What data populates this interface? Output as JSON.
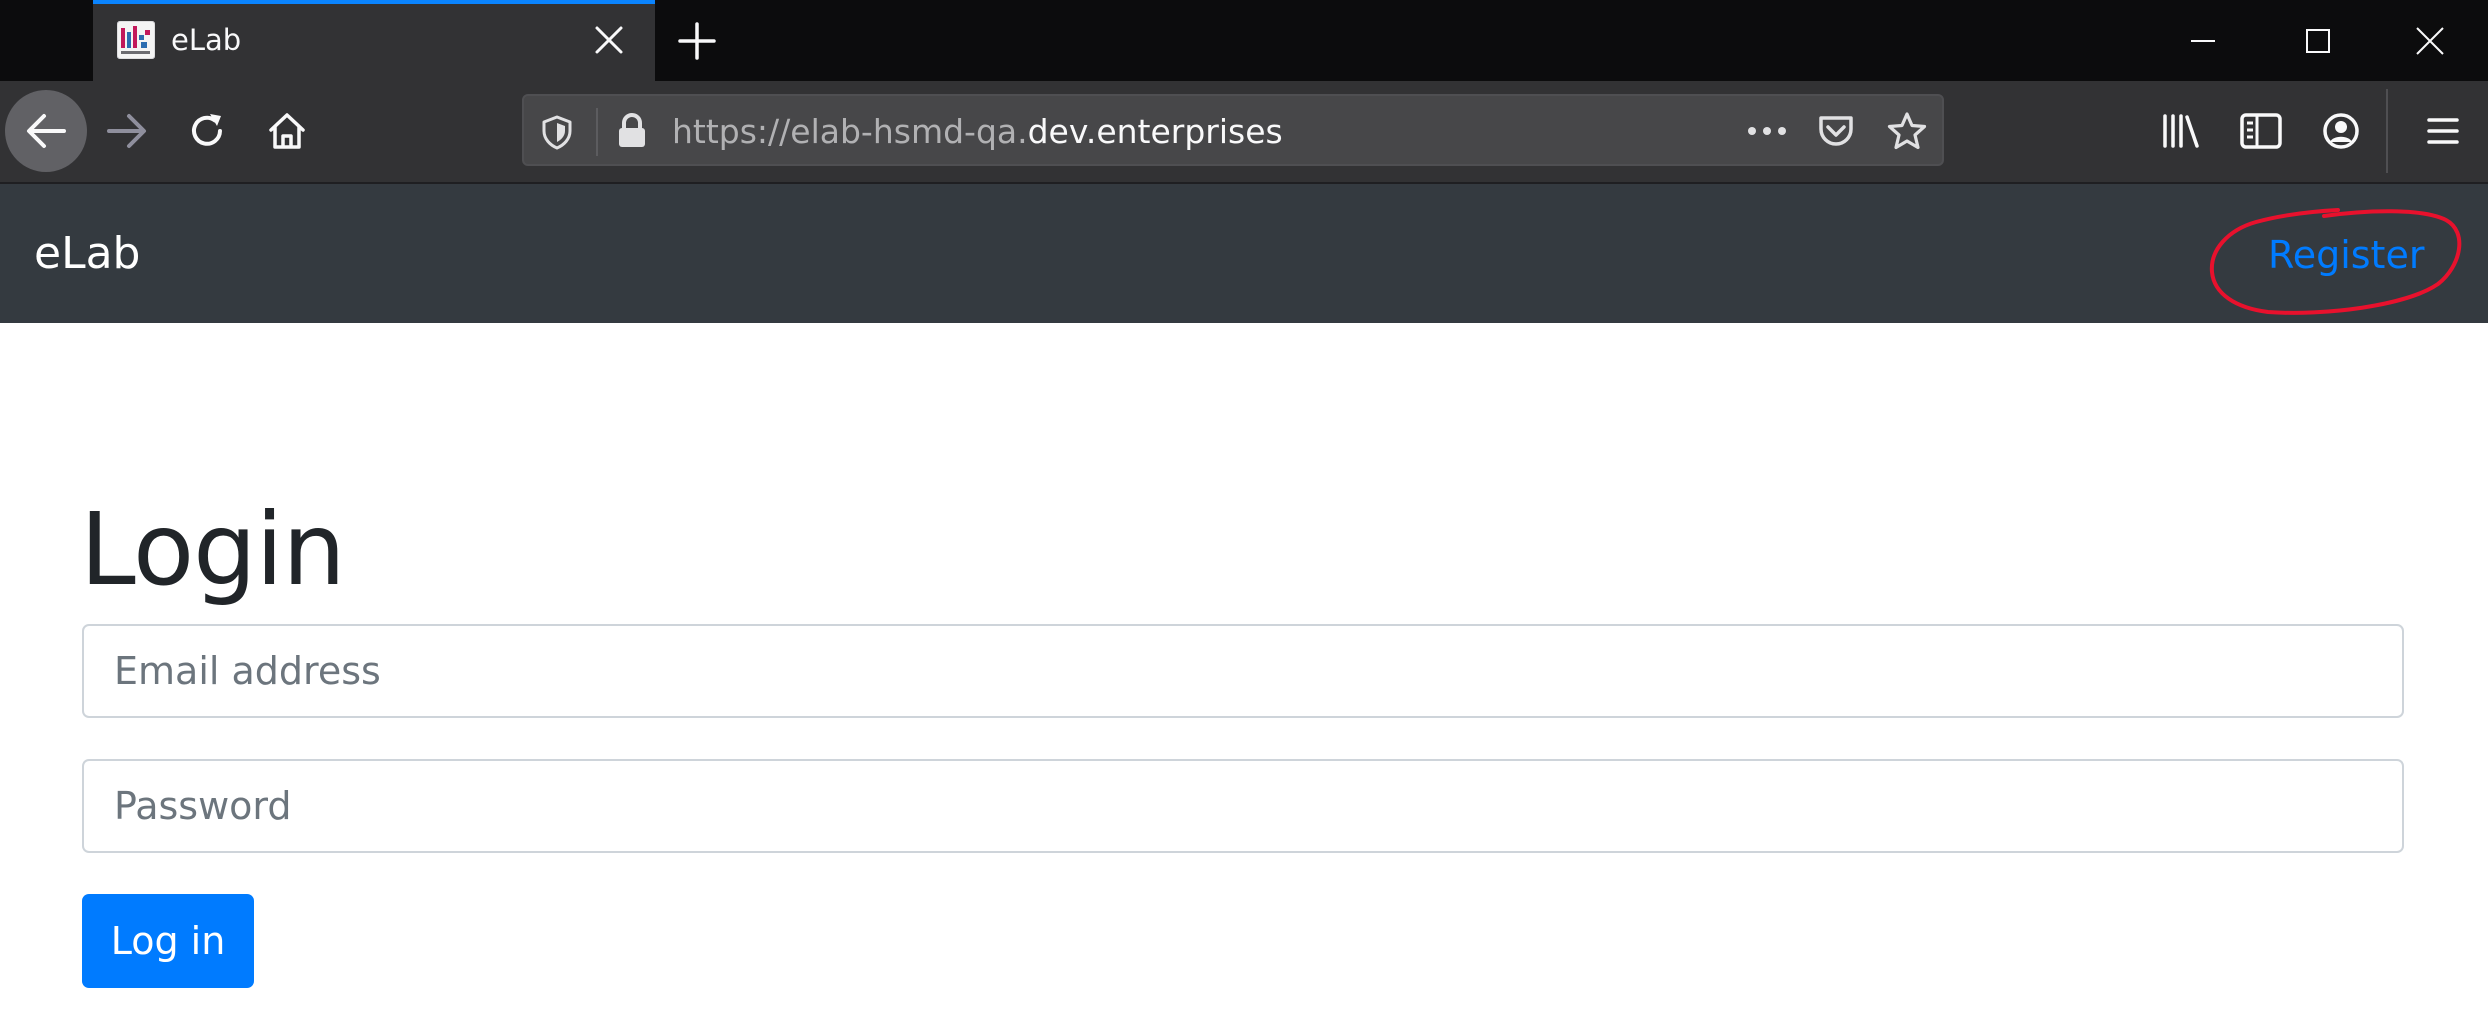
{
  "browser": {
    "tab": {
      "title": "eLab"
    },
    "url": {
      "prefix": "https://elab-hsmd-qa.",
      "host": "dev.enterprises"
    }
  },
  "site": {
    "brand": "eLab",
    "nav": {
      "register_label": "Register"
    }
  },
  "login": {
    "title": "Login",
    "email_placeholder": "Email address",
    "password_placeholder": "Password",
    "submit_label": "Log in"
  },
  "colors": {
    "browser_chrome": "#323234",
    "tab_accent": "#0a84ff",
    "site_navbar": "#343a40",
    "link": "#007bff",
    "primary_button": "#007bff",
    "annotation": "#e8112d"
  },
  "icons": {
    "tab_close": "close-icon",
    "new_tab": "plus-icon",
    "back": "arrow-left-icon",
    "forward": "arrow-right-icon",
    "reload": "reload-icon",
    "home": "home-icon",
    "tracking": "shield-icon",
    "lock": "lock-icon",
    "page_actions": "more-icon",
    "pocket": "pocket-icon",
    "bookmark": "star-icon",
    "library": "library-icon",
    "sidebar": "sidebar-icon",
    "account": "account-icon",
    "menu": "hamburger-icon"
  }
}
